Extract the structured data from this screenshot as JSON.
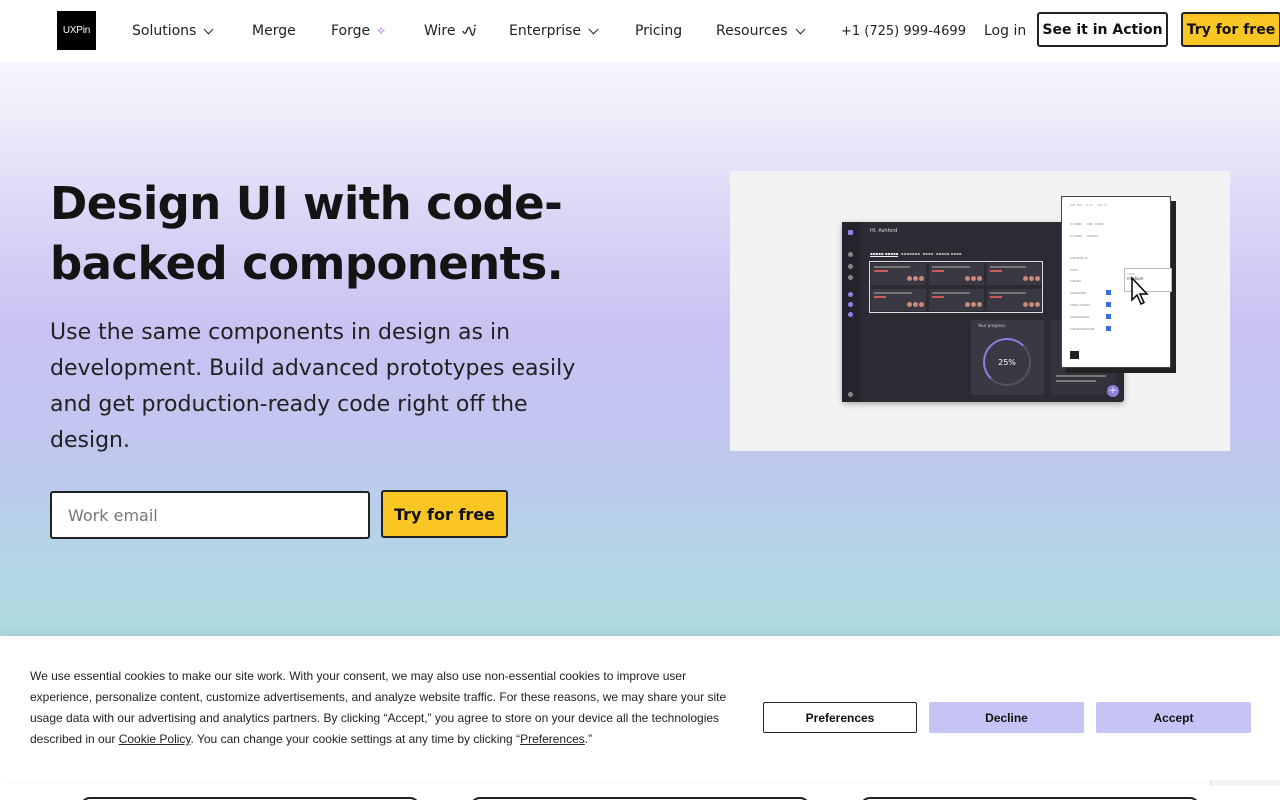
{
  "nav": {
    "logo_text": "UXPin",
    "items": [
      {
        "label": "Solutions"
      },
      {
        "label": "Merge"
      },
      {
        "label": "Forge"
      },
      {
        "label": "Wire"
      },
      {
        "label": "Enterprise"
      },
      {
        "label": "Pricing"
      },
      {
        "label": "Resources"
      }
    ],
    "phone": "+1 (725) 999-4699",
    "login": "Log in",
    "see_action": "See it in Action",
    "try_free": "Try for free"
  },
  "hero": {
    "title": "Design UI with code-backed components.",
    "subtitle": "Use the same components in design as in development. Build advanced prototypes easily and get production-ready code right off the design.",
    "email_placeholder": "Work email",
    "try_free": "Try for free"
  },
  "preview": {
    "greeting": "Hi, Ashford",
    "progress_title": "Your progress",
    "progress_value": "25%",
    "dropdown_value": "medium"
  },
  "cookie": {
    "text_before_link": "We use essential cookies to make our site work. With your consent, we may also use non-essential cookies to improve user experience, personalize content, customize advertisements, and analyze website traffic. For these reasons, we may share your site usage data with our advertising and analytics partners. By clicking “Accept,” you agree to store on your device all the technologies described in our ",
    "policy_link": "Cookie Policy",
    "text_middle": ". You can change your cookie settings at any time by clicking “",
    "preferences_link": "Preferences",
    "text_end": ".”",
    "preferences_btn": "Preferences",
    "decline_btn": "Decline",
    "accept_btn": "Accept"
  },
  "colors": {
    "accent_yellow": "#f9c623",
    "cookie_button": "#c6c3f6",
    "dashboard_bg": "#2c2a33"
  }
}
